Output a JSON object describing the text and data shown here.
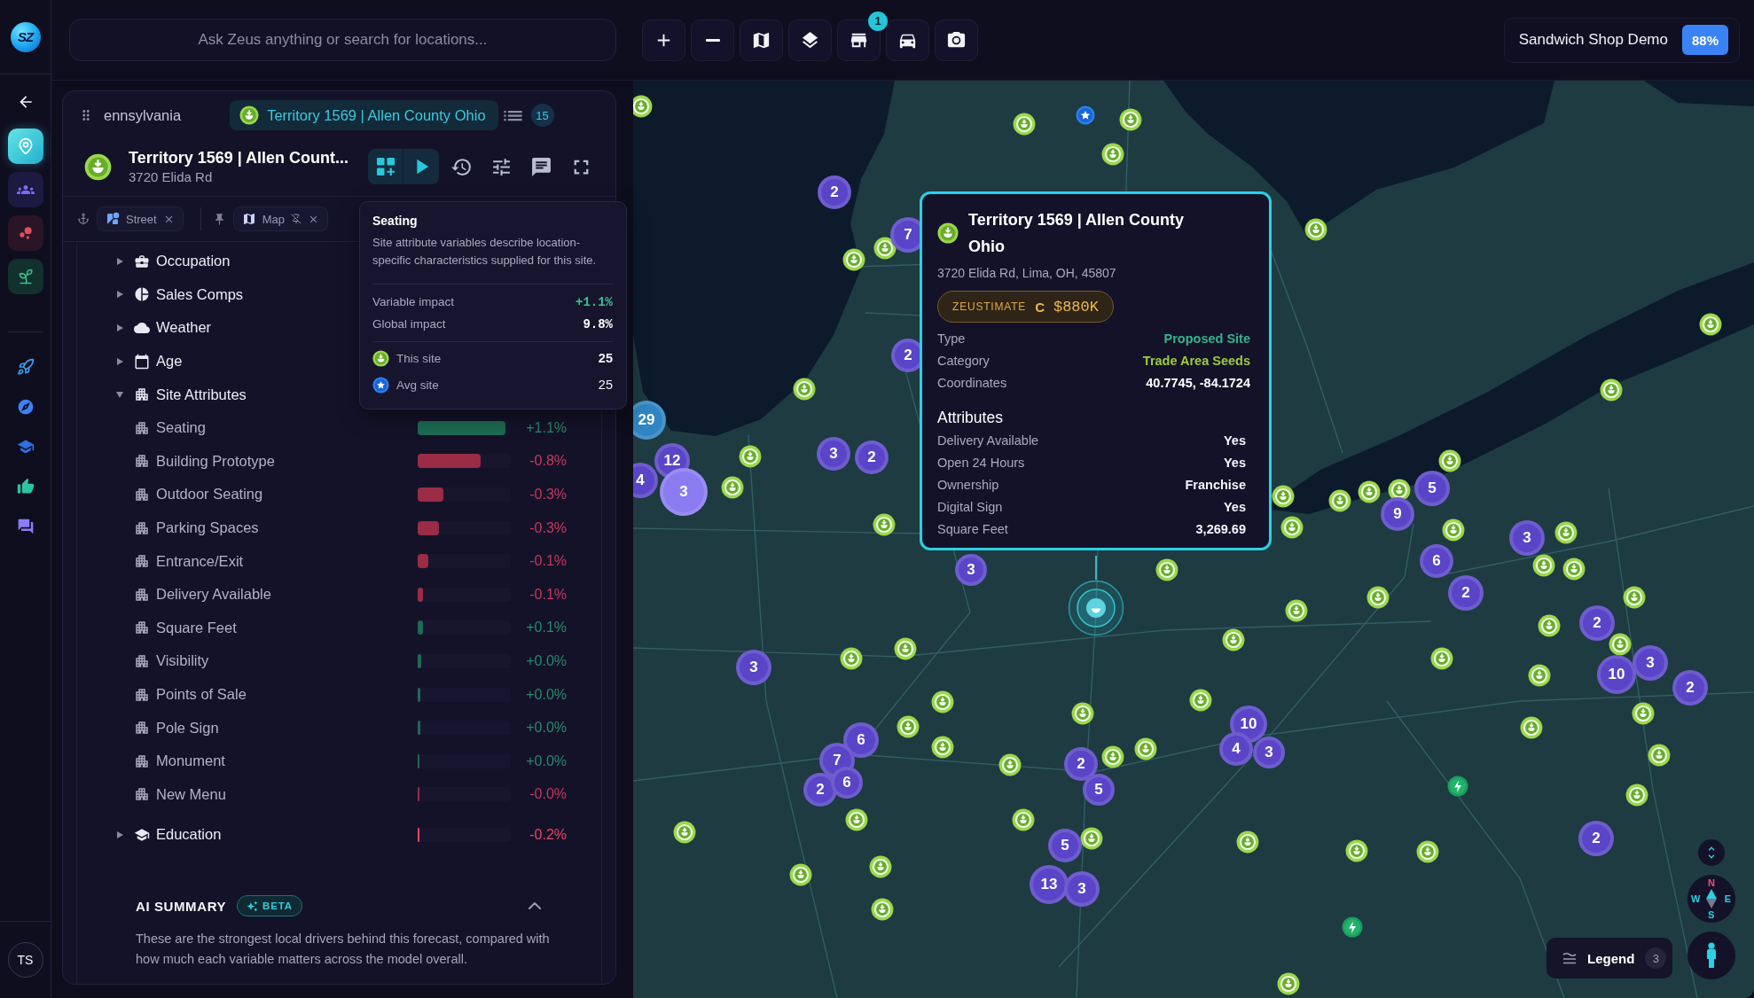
{
  "rail": {
    "logo": "SZ",
    "apps": [
      {
        "selected": true
      },
      {
        "selected": false
      },
      {
        "selected": false
      },
      {
        "selected": false
      }
    ],
    "user_initials": "TS"
  },
  "search": {
    "placeholder": "Ask Zeus anything or search for locations..."
  },
  "toolbar": {
    "store_badge": "1"
  },
  "workspace": {
    "name": "Sandwich Shop Demo",
    "score": "88%"
  },
  "panel": {
    "tabs": [
      {
        "label": "ennsylvania",
        "selected": false
      },
      {
        "label": "Territory 1569 | Allen County Ohio",
        "selected": true
      }
    ],
    "tab_count": "15",
    "site": {
      "title": "Territory 1569 | Allen Count...",
      "address": "3720 Elida Rd"
    },
    "filters": [
      {
        "kind": "street",
        "label": "Street"
      },
      {
        "kind": "map",
        "label": "Map"
      }
    ],
    "variables": [
      {
        "label": "Occupation",
        "expanded": false
      },
      {
        "label": "Sales Comps",
        "expanded": false
      },
      {
        "label": "Weather",
        "expanded": false
      },
      {
        "label": "Age",
        "expanded": false
      },
      {
        "label": "Site Attributes",
        "expanded": true,
        "children": [
          {
            "label": "Seating",
            "level": 0.94,
            "value": "+1.1%",
            "color": "#1d6b52"
          },
          {
            "label": "Building Prototype",
            "level": 0.68,
            "value": "-0.8%",
            "color": "#9a2c45"
          },
          {
            "label": "Outdoor Seating",
            "level": 0.28,
            "value": "-0.3%",
            "color": "#9a2c45"
          },
          {
            "label": "Parking Spaces",
            "level": 0.23,
            "value": "-0.3%",
            "color": "#9a2c45"
          },
          {
            "label": "Entrance/Exit",
            "level": 0.11,
            "value": "-0.1%",
            "color": "#9a2c45"
          },
          {
            "label": "Delivery Available",
            "level": 0.06,
            "value": "-0.1%",
            "color": "#9a2c45"
          },
          {
            "label": "Square Feet",
            "level": 0.06,
            "value": "+0.1%",
            "color": "#1d6b52"
          },
          {
            "label": "Visibility",
            "level": 0.04,
            "value": "+0.0%",
            "color": "#1d6b52"
          },
          {
            "label": "Points of Sale",
            "level": 0.03,
            "value": "+0.0%",
            "color": "#1d6b52"
          },
          {
            "label": "Pole Sign",
            "level": 0.03,
            "value": "+0.0%",
            "color": "#1d6b52"
          },
          {
            "label": "Monument",
            "level": 0.02,
            "value": "+0.0%",
            "color": "#1d6b52"
          },
          {
            "label": "New Menu",
            "level": 0.01,
            "value": "-0.0%",
            "color": "#9a2c45"
          }
        ]
      },
      {
        "label": "Education",
        "expanded": false,
        "level": 0.02,
        "value": "-0.2%",
        "color": "#e8475f"
      }
    ],
    "ai_summary": {
      "title": "AI SUMMARY",
      "badge": "BETA",
      "expanded": true,
      "text": "These are the strongest local drivers behind this forecast, compared with how much each variable matters across the model overall."
    }
  },
  "tooltip": {
    "title": "Seating",
    "description": "Site attribute variables describe location-specific characteristics supplied for this site.",
    "stats": [
      {
        "label": "Variable impact",
        "value": "+1.1%",
        "color": "#35c48f"
      },
      {
        "label": "Global impact",
        "value": "9.8%",
        "color": "#ffffff"
      }
    ],
    "sites": [
      {
        "label": "This site",
        "value": "25"
      },
      {
        "label": "Avg site",
        "value": "25"
      }
    ]
  },
  "map": {
    "clusters": [
      {
        "count": "2",
        "color": "#5a45c8"
      },
      {
        "count": "7",
        "color": "#5a45c8"
      },
      {
        "count": "2",
        "color": "#5a45c8"
      },
      {
        "count": "29",
        "color": "#2f86c2"
      },
      {
        "count": "12",
        "color": "#5a45c8"
      },
      {
        "count": "4",
        "color": "#5a45c8"
      },
      {
        "count": "3",
        "color": "#8a7bf0"
      },
      {
        "count": "3",
        "color": "#5a45c8"
      },
      {
        "count": "2",
        "color": "#5a45c8"
      },
      {
        "count": "3",
        "color": "#5a45c8"
      },
      {
        "count": "3",
        "color": "#5a45c8"
      },
      {
        "count": "6",
        "color": "#5a45c8"
      },
      {
        "count": "7",
        "color": "#5a45c8"
      },
      {
        "count": "2",
        "color": "#5a45c8"
      },
      {
        "count": "6",
        "color": "#5a45c8"
      },
      {
        "count": "2",
        "color": "#5a45c8"
      },
      {
        "count": "5",
        "color": "#5a45c8"
      },
      {
        "count": "5",
        "color": "#5a45c8"
      },
      {
        "count": "13",
        "color": "#5a45c8"
      },
      {
        "count": "3",
        "color": "#5a45c8"
      },
      {
        "count": "10",
        "color": "#5a45c8"
      },
      {
        "count": "4",
        "color": "#5a45c8"
      },
      {
        "count": "3",
        "color": "#5a45c8"
      },
      {
        "count": "9",
        "color": "#5a45c8"
      },
      {
        "count": "5",
        "color": "#5a45c8"
      },
      {
        "count": "6",
        "color": "#5a45c8"
      },
      {
        "count": "2",
        "color": "#5a45c8"
      },
      {
        "count": "3",
        "color": "#5a45c8"
      },
      {
        "count": "2",
        "color": "#5a45c8"
      },
      {
        "count": "3",
        "color": "#5a45c8"
      },
      {
        "count": "10",
        "color": "#5a45c8"
      },
      {
        "count": "2",
        "color": "#5a45c8"
      },
      {
        "count": "2",
        "color": "#5a45c8"
      }
    ],
    "popup": {
      "title": "Territory 1569 | Allen County Ohio",
      "address": "3720 Elida Rd, Lima, OH, 45807",
      "zeustimate": {
        "label": "ZEUSTIMATE",
        "grade": "C",
        "value": "$880K"
      },
      "details": [
        {
          "label": "Type",
          "value": "Proposed Site",
          "color": "#35b48a"
        },
        {
          "label": "Category",
          "value": "Trade Area Seeds",
          "color": "#9ccc3f"
        },
        {
          "label": "Coordinates",
          "value": "40.7745, -84.1724",
          "color": "#ffffff"
        }
      ],
      "attributes_title": "Attributes",
      "attributes": [
        {
          "label": "Delivery Available",
          "value": "Yes"
        },
        {
          "label": "Open 24 Hours",
          "value": "Yes"
        },
        {
          "label": "Ownership",
          "value": "Franchise"
        },
        {
          "label": "Digital Sign",
          "value": "Yes"
        },
        {
          "label": "Square Feet",
          "value": "3,269.69"
        }
      ]
    },
    "compass": {
      "north": "N",
      "west": "W",
      "east": "E",
      "south": "S"
    },
    "legend": {
      "label": "Legend",
      "count": "3"
    }
  }
}
